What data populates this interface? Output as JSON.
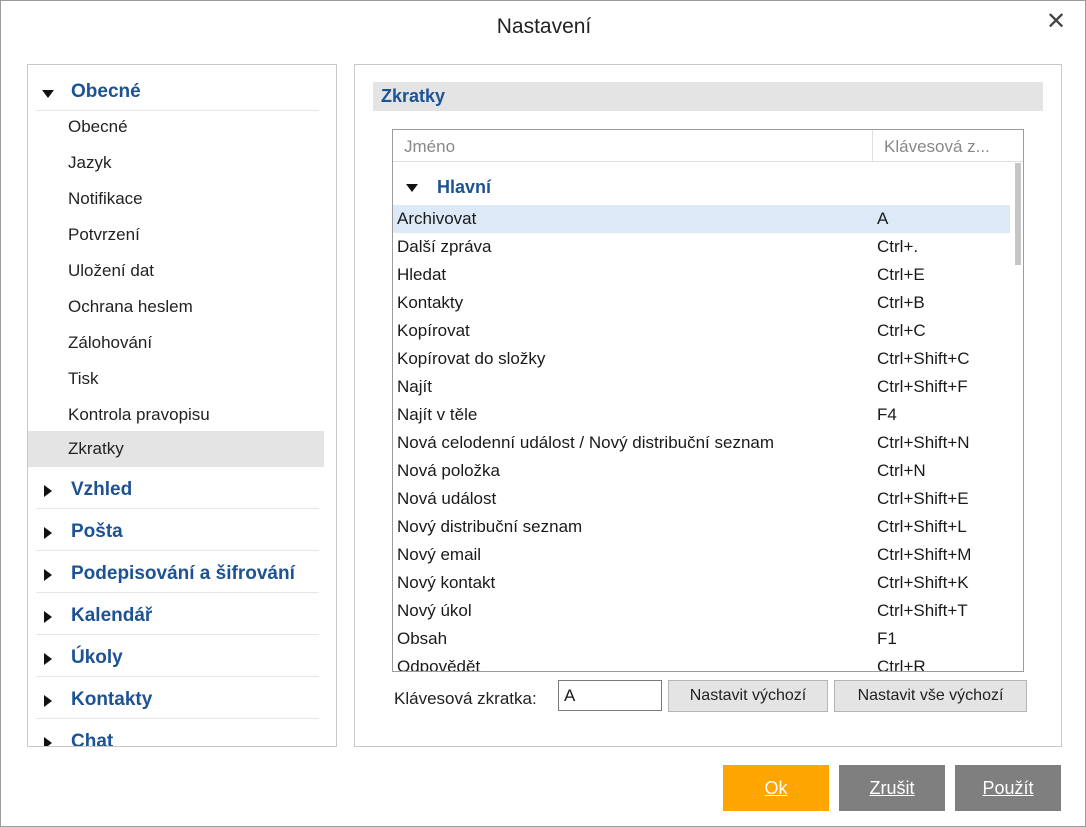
{
  "dialog": {
    "title": "Nastavení"
  },
  "nav": {
    "expanded_group": "Obecné",
    "items": [
      "Obecné",
      "Jazyk",
      "Notifikace",
      "Potvrzení",
      "Uložení dat",
      "Ochrana heslem",
      "Zálohování",
      "Tisk",
      "Kontrola pravopisu",
      "Zkratky"
    ],
    "selected_item": "Zkratky",
    "collapsed_groups": [
      "Vzhled",
      "Pošta",
      "Podepisování a šifrování",
      "Kalendář",
      "Úkoly",
      "Kontakty",
      "Chat"
    ]
  },
  "panel": {
    "section_title": "Zkratky",
    "table": {
      "columns": [
        "Jméno",
        "Klávesová z..."
      ],
      "group": "Hlavní",
      "rows": [
        {
          "name": "Archivovat",
          "key": "A"
        },
        {
          "name": "Další zpráva",
          "key": "Ctrl+."
        },
        {
          "name": "Hledat",
          "key": "Ctrl+E"
        },
        {
          "name": "Kontakty",
          "key": "Ctrl+B"
        },
        {
          "name": "Kopírovat",
          "key": "Ctrl+C"
        },
        {
          "name": "Kopírovat do složky",
          "key": "Ctrl+Shift+C"
        },
        {
          "name": "Najít",
          "key": "Ctrl+Shift+F"
        },
        {
          "name": "Najít v těle",
          "key": "F4"
        },
        {
          "name": "Nová celodenní událost / Nový distribuční seznam",
          "key": "Ctrl+Shift+N"
        },
        {
          "name": "Nová položka",
          "key": "Ctrl+N"
        },
        {
          "name": "Nová událost",
          "key": "Ctrl+Shift+E"
        },
        {
          "name": "Nový distribuční seznam",
          "key": "Ctrl+Shift+L"
        },
        {
          "name": "Nový email",
          "key": "Ctrl+Shift+M"
        },
        {
          "name": "Nový kontakt",
          "key": "Ctrl+Shift+K"
        },
        {
          "name": "Nový úkol",
          "key": "Ctrl+Shift+T"
        },
        {
          "name": "Obsah",
          "key": "F1"
        },
        {
          "name": "Odpovědět",
          "key": "Ctrl+R"
        }
      ],
      "selected_row": 0
    },
    "shortcut_label": "Klávesová zkratka:",
    "shortcut_value": "A",
    "set_default_label": "Nastavit výchozí",
    "set_all_default_label": "Nastavit vše výchozí"
  },
  "footer": {
    "ok_label": "Ok",
    "cancel_label": "Zrušit",
    "apply_label": "Použít"
  },
  "colors": {
    "accent": "#1d5293",
    "ok_button": "#ffa500",
    "secondary_button": "#7f7f7f",
    "selected_row": "#dce9f7"
  }
}
